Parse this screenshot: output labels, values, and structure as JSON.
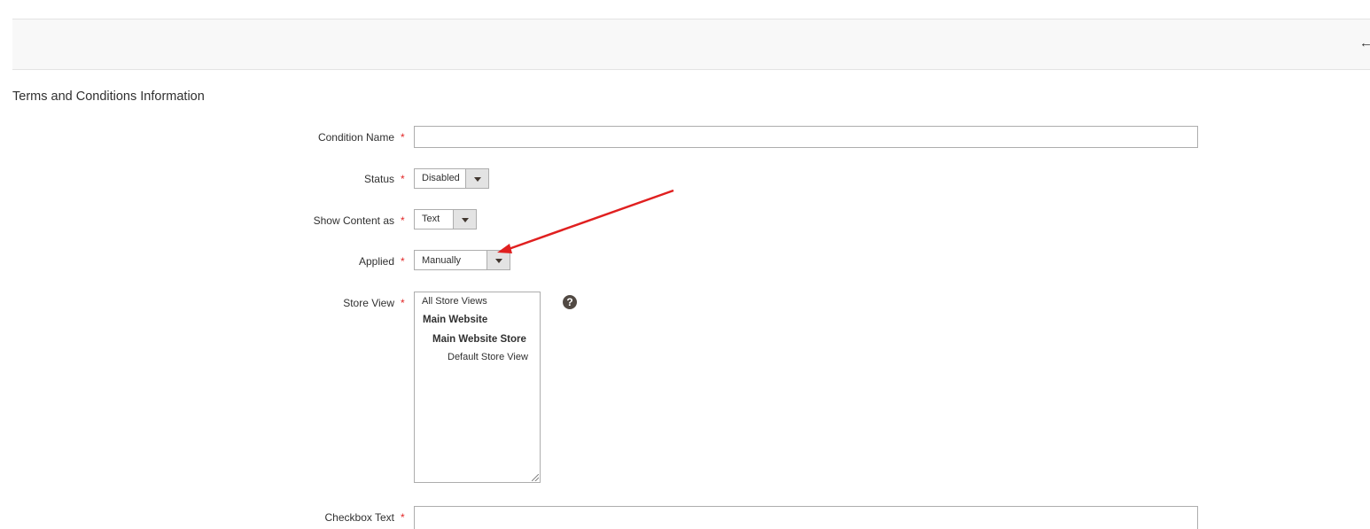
{
  "header": {
    "back_icon": "arrow-left-icon",
    "back_glyph": "←"
  },
  "section": {
    "title": "Terms and Conditions Information"
  },
  "form": {
    "required_mark": "*",
    "condition_name": {
      "label": "Condition Name",
      "value": ""
    },
    "status": {
      "label": "Status",
      "selected": "Disabled"
    },
    "show_content_as": {
      "label": "Show Content as",
      "selected": "Text"
    },
    "applied": {
      "label": "Applied",
      "selected": "Manually"
    },
    "store_view": {
      "label": "Store View",
      "options": {
        "all": "All Store Views",
        "website": "Main Website",
        "store": "Main Website Store",
        "view": "Default Store View"
      },
      "help_icon": "question-circle-icon",
      "help_glyph": "?"
    },
    "checkbox_text": {
      "label": "Checkbox Text",
      "value": ""
    }
  },
  "colors": {
    "required": "#e22626",
    "annotation_arrow": "#e02020",
    "action_bar_bg": "#f8f8f8",
    "input_border": "#adadad"
  }
}
